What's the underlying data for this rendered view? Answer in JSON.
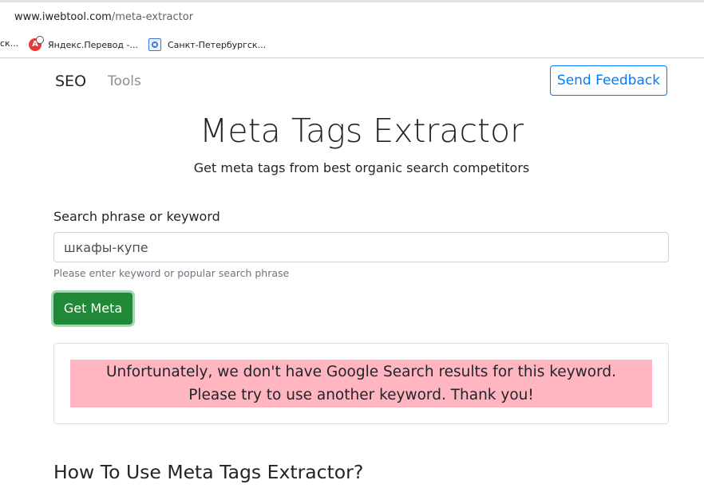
{
  "browser": {
    "url_host": "www.iwebtool.com",
    "url_path": "/meta-extractor",
    "bookmarks": [
      {
        "label": "ск..."
      },
      {
        "label": "Яндекс.Перевод -...",
        "icon": "yandex-translate-icon"
      },
      {
        "label": "Санкт-Петербургск...",
        "icon": "globe-map-icon"
      }
    ]
  },
  "nav": {
    "brand": "SEO",
    "tools": "Tools",
    "feedback_button": "Send Feedback"
  },
  "hero": {
    "title": "Meta Tags Extractor",
    "subtitle": "Get meta tags from best organic search competitors"
  },
  "form": {
    "label": "Search phrase or keyword",
    "value": "шкафы-купе",
    "help": "Please enter keyword or popular search phrase",
    "submit_label": "Get Meta"
  },
  "result": {
    "line1": "Unfortunately, we don't have Google Search results for this keyword.",
    "line2": "Please try to use another keyword. Thank you!"
  },
  "section": {
    "heading": "How To Use Meta Tags Extractor?"
  },
  "colors": {
    "primary": "#007bff",
    "success": "#218838",
    "alert_bg": "#ffb6c1"
  }
}
